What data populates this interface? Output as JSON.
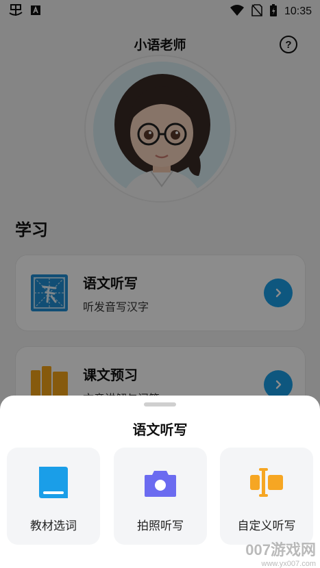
{
  "status_bar": {
    "time": "10:35",
    "left_icons": [
      "app-notification-icon",
      "keyboard-icon"
    ],
    "right_icons": [
      "wifi-icon",
      "no-sim-icon",
      "battery-charging-icon"
    ]
  },
  "header": {
    "title": "小语老师",
    "help_glyph": "?"
  },
  "learning": {
    "section_title": "学习",
    "courses": [
      {
        "title": "语文听写",
        "subtitle": "听发音写汉字",
        "icon": "dictation-grid-icon",
        "arrow": "›"
      },
      {
        "title": "课文预习",
        "subtitle": "文章讲解与问答",
        "icon": "books-icon",
        "arrow": "›"
      }
    ]
  },
  "sheet": {
    "title": "语文听写",
    "options": [
      {
        "label": "教材选词",
        "icon": "book-icon",
        "color": "#1a9ee8"
      },
      {
        "label": "拍照听写",
        "icon": "camera-icon",
        "color": "#6b6bf0"
      },
      {
        "label": "自定义听写",
        "icon": "text-cursor-icon",
        "color": "#f6a623"
      }
    ]
  },
  "watermark": {
    "main": "007游戏网",
    "url": "www.yx007.com"
  },
  "colors": {
    "accent_blue": "#1a9ee8",
    "accent_purple": "#6b6bf0",
    "accent_orange": "#f6a623"
  }
}
